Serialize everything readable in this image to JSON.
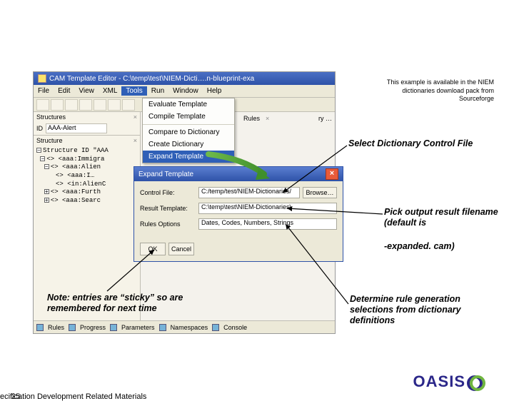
{
  "availability": "This example is available in the NIEM dictionaries download pack from Sourceforge",
  "editor": {
    "title": "CAM Template Editor - C:\\temp\\test\\NIEM-Dicti….n-blueprint-exa",
    "menu": [
      "File",
      "Edit",
      "View",
      "XML",
      "Tools",
      "Run",
      "Window",
      "Help"
    ],
    "tabs_left": {
      "structures": "Structures",
      "id_label": "ID",
      "id_value": "AAA-Alert",
      "structure": "Structure"
    },
    "tools_menu": {
      "evaluate": "Evaluate Template",
      "compile": "Compile Template",
      "compare": "Compare to Dictionary",
      "create": "Create Dictionary",
      "expand": "Expand Template"
    },
    "tree": [
      "Structure ID \"AAA",
      "<aaa:Immigra",
      "<aaa:Alien",
      "<aaa:I…",
      "<in:AlienC",
      "<aaa:Furth",
      "<aaa:Searc"
    ],
    "right_tabs": {
      "rules": "Rules",
      "more": "ry …"
    },
    "bottom": {
      "rules": "Rules",
      "progress": "Progress",
      "parameters": "Parameters",
      "namespaces": "Namespaces",
      "console": "Console"
    }
  },
  "dialog": {
    "title": "Expand Template",
    "control_label": "Control File:",
    "control_value": "C:/temp/test/NIEM-Dictionaries/",
    "browse": "Browse…",
    "result_label": "Result Template:",
    "result_value": "C:\\temp\\test\\NIEM-Dictionaries\\",
    "rules_label": "Rules Options",
    "rules_value": "Dates, Codes, Numbers, Strings",
    "ok": "OK",
    "cancel": "Cancel"
  },
  "callouts": {
    "c1": "Select Dictionary Control File",
    "c2": "Pick output result filename (default is",
    "c3": "-expanded. cam)",
    "c4": "Determine rule generation selections from dictionary definitions",
    "note": "Note: entries are “sticky” so are remembered for next time"
  },
  "logo": "OASIS",
  "footer_text": "ecification Development Related Materials",
  "page_no": "25"
}
